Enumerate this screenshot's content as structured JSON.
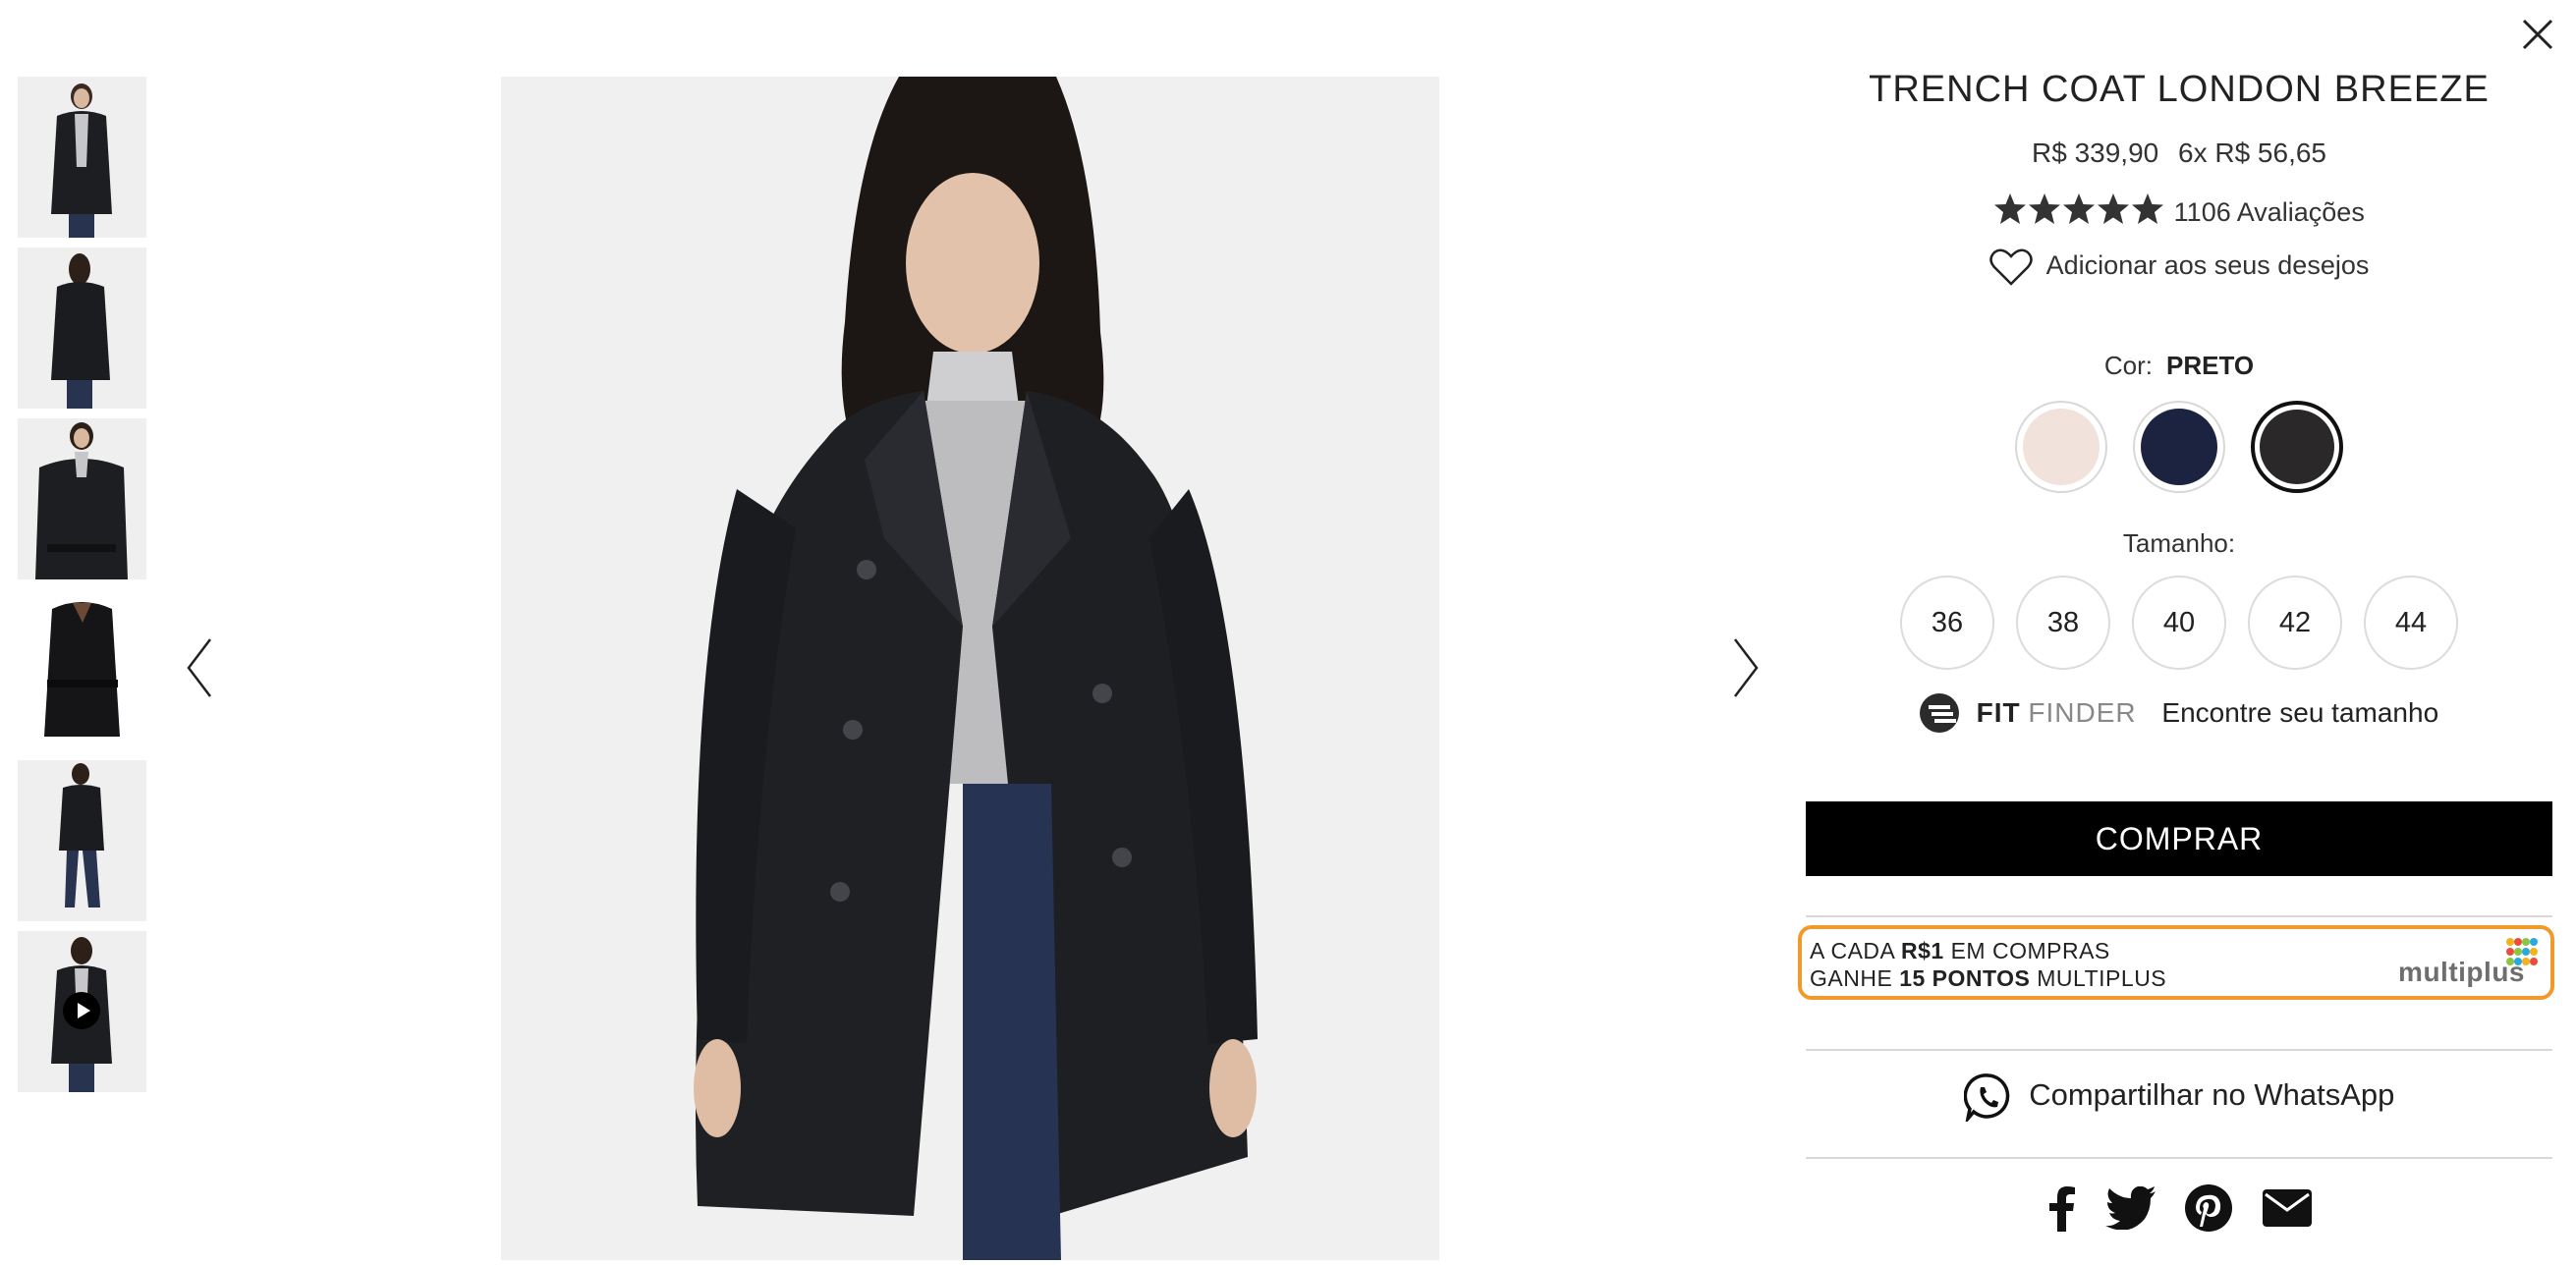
{
  "product": {
    "title": "TRENCH COAT LONDON BREEZE",
    "price": "R$ 339,90",
    "installments": "6x R$ 56,65",
    "rating_stars": 5,
    "reviews": "1106 Avaliações",
    "wishlist": "Adicionar aos seus desejos"
  },
  "color": {
    "label": "Cor:",
    "selected": "PRETO",
    "swatches": [
      {
        "name": "bege",
        "hex": "#f2e2dc"
      },
      {
        "name": "marinho",
        "hex": "#1c2340"
      },
      {
        "name": "preto",
        "hex": "#2b2829"
      }
    ]
  },
  "size": {
    "label": "Tamanho:",
    "options": [
      "36",
      "38",
      "40",
      "42",
      "44"
    ]
  },
  "fit_finder": {
    "brand_bold": "FIT",
    "brand_light": "FINDER",
    "text": "Encontre seu tamanho"
  },
  "buy_label": "COMPRAR",
  "promo": {
    "line1_pre": "A CADA ",
    "line1_bold": "R$1",
    "line1_post": " EM COMPRAS",
    "line2_pre": "GANHE ",
    "line2_bold": "15 PONTOS",
    "line2_post": " MULTIPLUS",
    "logo_text": "multiplus"
  },
  "share": {
    "whatsapp": "Compartilhar no WhatsApp",
    "icons": [
      "facebook-icon",
      "twitter-icon",
      "pinterest-icon",
      "email-icon"
    ]
  },
  "gallery": {
    "thumbnail_count": 6,
    "video_thumbnail": 6
  },
  "colors": {
    "accent": "#f19a2b",
    "buy_bg": "#000000"
  }
}
